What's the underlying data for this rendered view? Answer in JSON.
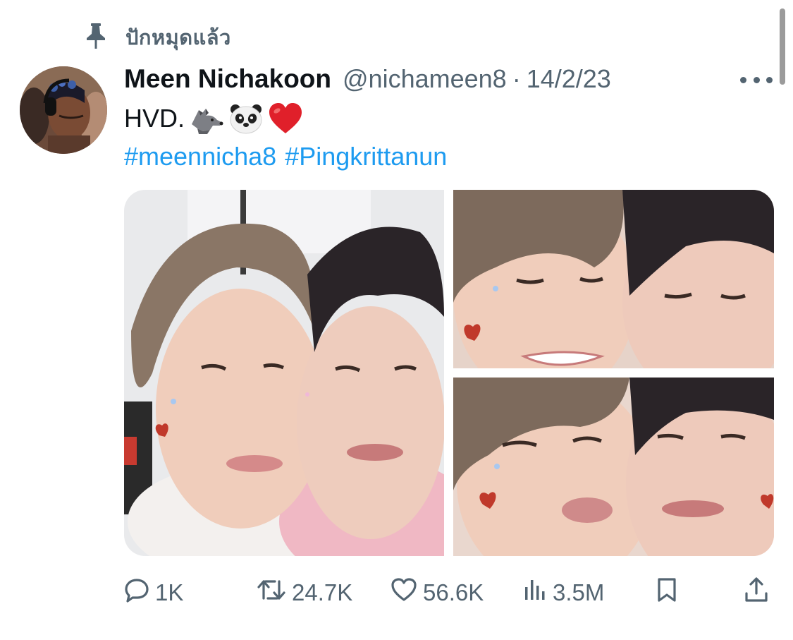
{
  "pinned": {
    "label": "ปักหมุดแล้ว",
    "icon": "pin-icon"
  },
  "tweet": {
    "author_name": "Meen Nichakoon",
    "handle": "@nichameen8",
    "separator": "·",
    "date": "14/2/23",
    "text": "HVD.",
    "emojis": [
      "wolf-emoji",
      "panda-emoji",
      "red-heart-emoji"
    ],
    "hashtags": [
      "#meennicha8",
      "#Pingkrittanun"
    ],
    "media_count": 3
  },
  "actions": {
    "replies": "1K",
    "reposts": "24.7K",
    "likes": "56.6K",
    "views": "3.5M"
  },
  "icons": [
    "pin-icon",
    "more-icon",
    "reply-icon",
    "repost-icon",
    "like-icon",
    "views-icon",
    "bookmark-icon",
    "share-icon"
  ],
  "colors": {
    "accent": "#1d9bf0",
    "secondary_text": "#536471",
    "primary_text": "#0f1419",
    "heart_emoji": "#e0202a"
  }
}
